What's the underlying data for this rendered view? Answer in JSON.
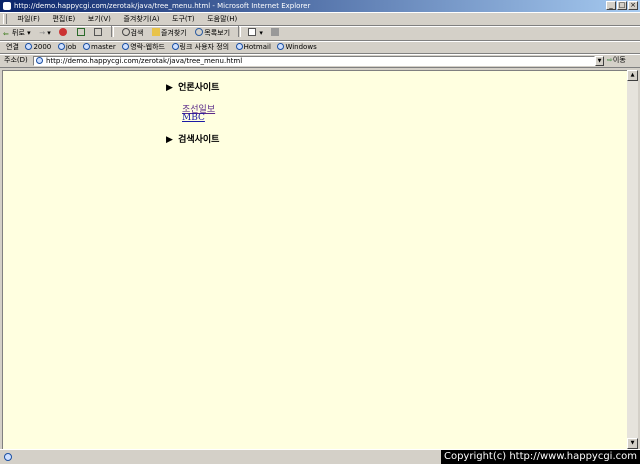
{
  "window": {
    "title": "http://demo.happycgi.com/zerotak/java/tree_menu.html - Microsoft Internet Explorer",
    "buttons": {
      "minimize": "_",
      "maximize": "□",
      "close": "×"
    }
  },
  "menubar": [
    "파일(F)",
    "편집(E)",
    "보기(V)",
    "즐겨찾기(A)",
    "도구(T)",
    "도움말(H)"
  ],
  "toolbar": {
    "back": "뒤로",
    "forward": "→",
    "search": "검색",
    "favorites": "즐겨찾기",
    "history": "목록보기"
  },
  "links": {
    "label": "연결",
    "items": [
      "2000",
      "job",
      "master",
      "영락-웹하드",
      "링크 사용자 정의",
      "Hotmail",
      "Windows"
    ]
  },
  "address": {
    "label": "주소(D)",
    "url": "http://demo.happycgi.com/zerotak/java/tree_menu.html",
    "go": "이동"
  },
  "tree": {
    "folder1": "언론사이트",
    "folder1_items": [
      "조선일보",
      "MBC"
    ],
    "folder2": "검색사이트",
    "arrow": "▶"
  },
  "status": {
    "copyright": "Copyright(c) http://www.happycgi.com"
  }
}
